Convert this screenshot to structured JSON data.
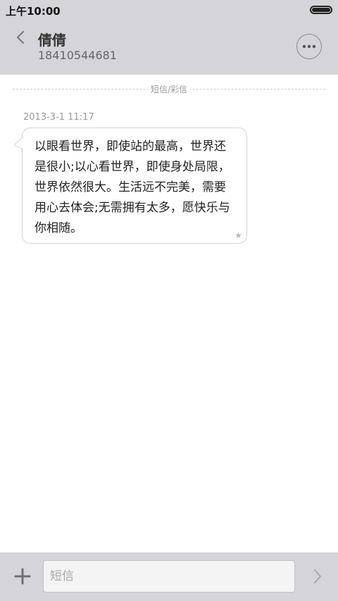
{
  "status_bar": {
    "time": "上午10:00"
  },
  "header": {
    "contact_name": "倩倩",
    "contact_number": "18410544681",
    "back_icon": "chevron-left-icon",
    "more_icon": "more-dots-icon"
  },
  "conversation": {
    "divider_label": "短信/彩信",
    "messages": [
      {
        "timestamp": "2013-3-1 11:17",
        "text": "以眼看世界，即使站的最高，世界还是很小;以心看世界，即使身处局限，世界依然很大。生活远不完美，需要用心去体会;无需拥有太多，愿快乐与你相随。",
        "star_glyph": "★"
      }
    ]
  },
  "input_bar": {
    "placeholder": "短信",
    "add_icon": "plus-icon",
    "send_icon": "chevron-right-icon"
  },
  "colors": {
    "bar_background": "#d5d5d9",
    "bubble_border": "#d4d4d4",
    "secondary_text": "#999999"
  }
}
